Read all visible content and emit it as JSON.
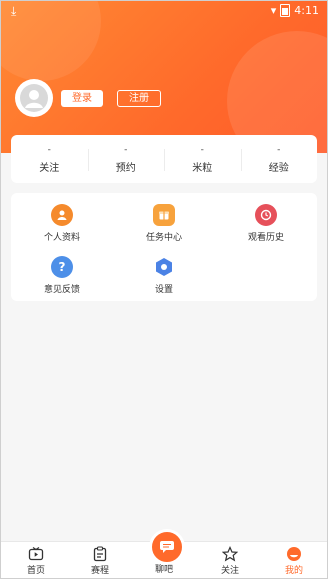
{
  "status": {
    "time": "4:11"
  },
  "profile": {
    "login_label": "登录",
    "register_label": "注册"
  },
  "stats": [
    {
      "value": "-",
      "label": "关注"
    },
    {
      "value": "-",
      "label": "预约"
    },
    {
      "value": "-",
      "label": "米粒"
    },
    {
      "value": "-",
      "label": "经验"
    }
  ],
  "grid": [
    {
      "label": "个人资料",
      "icon": "person-icon",
      "color": "#f58a2c"
    },
    {
      "label": "任务中心",
      "icon": "task-icon",
      "color": "#f7a23c"
    },
    {
      "label": "观看历史",
      "icon": "clock-icon",
      "color": "#e6505a"
    },
    {
      "label": "意见反馈",
      "icon": "question-icon",
      "color": "#4d8fe8"
    },
    {
      "label": "设置",
      "icon": "settings-icon",
      "color": "#4b82e5"
    }
  ],
  "tabbar": {
    "home": "首页",
    "matches": "赛程",
    "chat": "聊吧",
    "follow": "关注",
    "mine": "我的"
  },
  "colors": {
    "accent": "#ff6a2b"
  }
}
